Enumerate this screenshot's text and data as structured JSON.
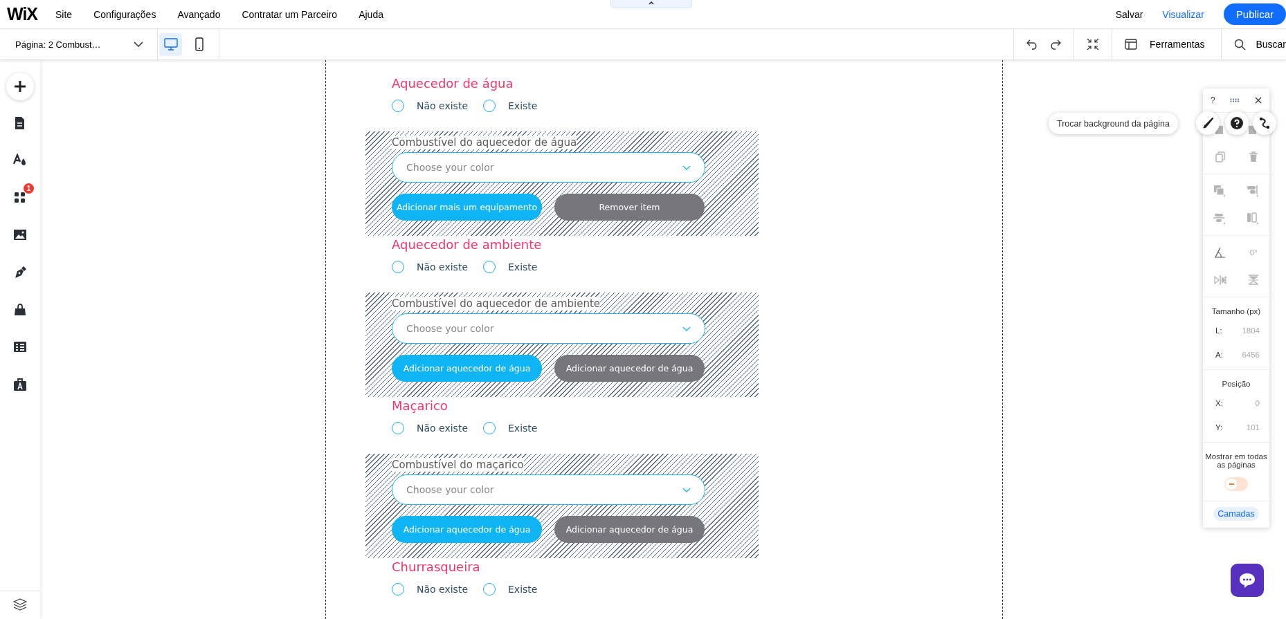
{
  "topbar": {
    "logo": "WiX",
    "menu": [
      "Site",
      "Configurações",
      "Avançado",
      "Contratar um Parceiro",
      "Ajuda"
    ],
    "actions": [
      {
        "label": "Salvar",
        "kind": "plain"
      },
      {
        "label": "Visualizar",
        "kind": "link"
      },
      {
        "label": "Publicar",
        "kind": "primary"
      }
    ]
  },
  "toolbar": {
    "page_selector": "Página: 2 Combust…",
    "devices": [
      {
        "kind": "desktop",
        "selected": true
      },
      {
        "kind": "mobile",
        "selected": false
      }
    ],
    "tools_label": "Ferramentas",
    "search_label": "Buscar"
  },
  "sidebar": {
    "items": [
      {
        "kind": "add"
      },
      {
        "kind": "pages"
      },
      {
        "kind": "design"
      },
      {
        "kind": "apps",
        "badge": "1"
      },
      {
        "kind": "media"
      },
      {
        "kind": "pen"
      },
      {
        "kind": "store"
      },
      {
        "kind": "table"
      },
      {
        "kind": "portfolio"
      }
    ]
  },
  "sections": [
    {
      "title": "Aquecedor de água",
      "options": [
        {
          "label": "Não existe",
          "selected": false
        },
        {
          "label": "Existe",
          "selected": false
        }
      ],
      "fuel": {
        "label": "Combustível do aquecedor de água",
        "placeholder": "Choose your color",
        "buttons": [
          {
            "label": "Adicionar mais um equipamento",
            "kind": "primary"
          },
          {
            "label": "Remover item",
            "kind": "secondary"
          }
        ]
      }
    },
    {
      "title": "Aquecedor de ambiente",
      "options": [
        {
          "label": "Não existe",
          "selected": false
        },
        {
          "label": "Existe",
          "selected": false
        }
      ],
      "fuel": {
        "label": "Combustível do aquecedor de ambiente",
        "placeholder": "Choose your color",
        "buttons": [
          {
            "label": "Adicionar aquecedor de água",
            "kind": "primary"
          },
          {
            "label": "Adicionar aquecedor de água",
            "kind": "secondary"
          }
        ]
      }
    },
    {
      "title": "Maçarico",
      "options": [
        {
          "label": "Não existe",
          "selected": false
        },
        {
          "label": "Existe",
          "selected": false
        }
      ],
      "fuel": {
        "label": "Combustível do maçarico",
        "placeholder": "Choose your color",
        "buttons": [
          {
            "label": "Adicionar aquecedor de água",
            "kind": "primary"
          },
          {
            "label": "Adicionar aquecedor de água",
            "kind": "secondary"
          }
        ]
      }
    },
    {
      "title": "Churrasqueira",
      "options": [
        {
          "label": "Não existe",
          "selected": false
        },
        {
          "label": "Existe",
          "selected": false
        }
      ]
    }
  ],
  "panel": {
    "help": "?",
    "tooltip": "Trocar background da página",
    "rotation": "0°",
    "size_title": "Tamanho (px)",
    "size": [
      {
        "label": "L:",
        "value": "1804"
      },
      {
        "label": "A:",
        "value": "6456"
      }
    ],
    "position_title": "Posição",
    "position": [
      {
        "label": "X:",
        "value": "0"
      },
      {
        "label": "Y:",
        "value": "101"
      }
    ],
    "show_all_label": "Mostrar em todas as páginas",
    "show_all_on": false,
    "layers": "Camadas"
  }
}
